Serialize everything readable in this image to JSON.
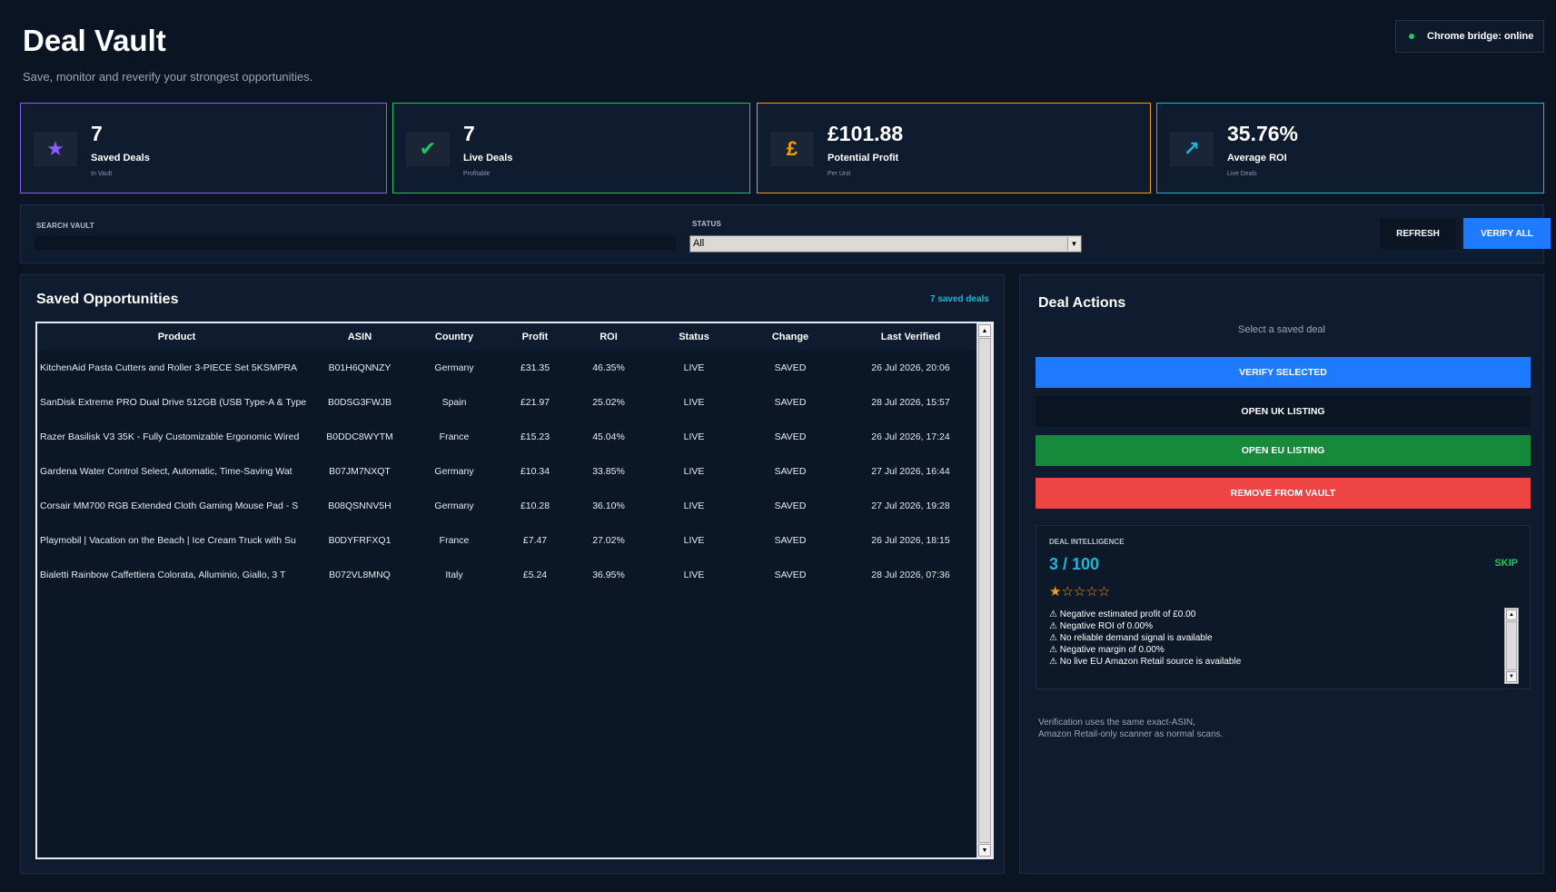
{
  "header": {
    "title": "Deal Vault",
    "subtitle": "Save, monitor and reverify your strongest opportunities.",
    "bridge_status": "Chrome bridge: online"
  },
  "stats": [
    {
      "value": "7",
      "label": "Saved Deals",
      "sub": "In Vault",
      "icon": "star-icon",
      "color": "#8b5cf6"
    },
    {
      "value": "7",
      "label": "Live Deals",
      "sub": "Profitable",
      "icon": "check-icon",
      "color": "#22c55e"
    },
    {
      "value": "£101.88",
      "label": "Potential Profit",
      "sub": "Per Unit",
      "icon": "pound-icon",
      "color": "#f59e0b"
    },
    {
      "value": "35.76%",
      "label": "Average ROI",
      "sub": "Live Deals",
      "icon": "trend-up-icon",
      "color": "#1fb5d6"
    }
  ],
  "filters": {
    "search_label": "SEARCH VAULT",
    "search_value": "",
    "search_placeholder": "",
    "status_label": "STATUS",
    "status_value": "All",
    "refresh_label": "REFRESH",
    "verify_all_label": "VERIFY ALL"
  },
  "opportunities": {
    "title": "Saved Opportunities",
    "count_label": "7 saved deals",
    "columns": [
      "Product",
      "ASIN",
      "Country",
      "Profit",
      "ROI",
      "Status",
      "Change",
      "Last Verified"
    ],
    "rows": [
      {
        "product": "KitchenAid Pasta Cutters and Roller 3-PIECE Set 5KSMPRA",
        "asin": "B01H6QNNZY",
        "country": "Germany",
        "profit": "£31.35",
        "roi": "46.35%",
        "status": "LIVE",
        "change": "SAVED",
        "verified": "26 Jul 2026, 20:06"
      },
      {
        "product": "SanDisk Extreme PRO Dual Drive 512GB (USB Type-A & Type",
        "asin": "B0DSG3FWJB",
        "country": "Spain",
        "profit": "£21.97",
        "roi": "25.02%",
        "status": "LIVE",
        "change": "SAVED",
        "verified": "28 Jul 2026, 15:57"
      },
      {
        "product": "Razer Basilisk V3 35K - Fully Customizable Ergonomic Wired",
        "asin": "B0DDC8WYTM",
        "country": "France",
        "profit": "£15.23",
        "roi": "45.04%",
        "status": "LIVE",
        "change": "SAVED",
        "verified": "26 Jul 2026, 17:24"
      },
      {
        "product": "Gardena Water Control Select, Automatic, Time-Saving Wat",
        "asin": "B07JM7NXQT",
        "country": "Germany",
        "profit": "£10.34",
        "roi": "33.85%",
        "status": "LIVE",
        "change": "SAVED",
        "verified": "27 Jul 2026, 16:44"
      },
      {
        "product": "Corsair MM700 RGB Extended Cloth Gaming Mouse Pad - S",
        "asin": "B08QSNNV5H",
        "country": "Germany",
        "profit": "£10.28",
        "roi": "36.10%",
        "status": "LIVE",
        "change": "SAVED",
        "verified": "27 Jul 2026, 19:28"
      },
      {
        "product": "Playmobil | Vacation on the Beach | Ice Cream Truck with Su",
        "asin": "B0DYFRFXQ1",
        "country": "France",
        "profit": "£7.47",
        "roi": "27.02%",
        "status": "LIVE",
        "change": "SAVED",
        "verified": "26 Jul 2026, 18:15"
      },
      {
        "product": "Bialetti Rainbow Caffettiera Colorata, Alluminio, Giallo, 3 T",
        "asin": "B072VL8MNQ",
        "country": "Italy",
        "profit": "£5.24",
        "roi": "36.95%",
        "status": "LIVE",
        "change": "SAVED",
        "verified": "28 Jul 2026, 07:36"
      }
    ]
  },
  "actions": {
    "title": "Deal Actions",
    "selection_hint": "Select a saved deal",
    "buttons": [
      {
        "label": "VERIFY SELECTED",
        "color": "#1e7bff"
      },
      {
        "label": "OPEN UK LISTING",
        "color": "#0a1423"
      },
      {
        "label": "OPEN EU LISTING",
        "color": "#168a3a"
      },
      {
        "label": "REMOVE FROM VAULT",
        "color": "#ef4444"
      }
    ],
    "intelligence": {
      "label": "DEAL INTELLIGENCE",
      "score": "3 / 100",
      "verdict": "SKIP",
      "rating": 1,
      "rating_max": 5,
      "stars": "★☆☆☆☆",
      "warnings": [
        "⚠ Negative estimated profit of £0.00",
        "⚠ Negative ROI of 0.00%",
        "⚠ No reliable demand signal is available",
        "⚠ Negative margin of 0.00%",
        "⚠ No live EU Amazon Retail source is available"
      ]
    },
    "footnote_line1": "Verification uses the same exact-ASIN,",
    "footnote_line2": "Amazon Retail-only scanner as normal scans."
  }
}
